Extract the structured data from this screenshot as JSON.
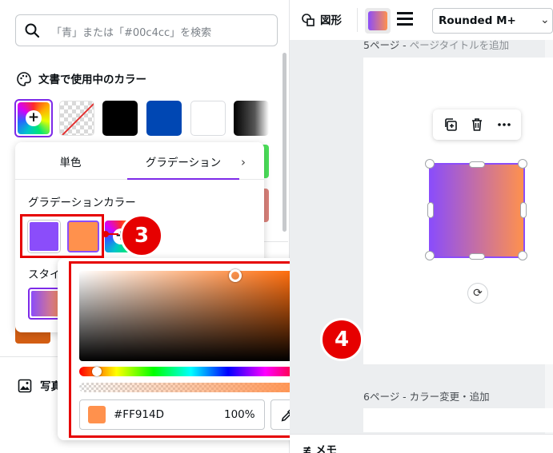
{
  "search": {
    "placeholder": "「青」または「#00c4cc」を検索"
  },
  "left_panel": {
    "doc_colors_title": "文書で使用中のカラー",
    "doc_colors": [
      "#000000",
      "#0047b3",
      "#ffffff"
    ],
    "photo_section_label": "写真の"
  },
  "gradient_popup": {
    "tabs": [
      {
        "label": "単色",
        "selected": false
      },
      {
        "label": "グラデーション",
        "selected": true
      }
    ],
    "next_arrow": "›",
    "gradient_colors_title": "グラデーションカラー",
    "gradient_stops": [
      "#8b4dfa",
      "#ff914d"
    ],
    "add_stop_label": "+",
    "style_title": "スタイル"
  },
  "color_picker": {
    "hex": "#FF914D",
    "opacity": "100%"
  },
  "annotations": {
    "badge_3": "3",
    "badge_4": "4"
  },
  "toolbar": {
    "shape_label": "図形",
    "font_name": "Rounded M+",
    "font_chevron": "⌄"
  },
  "canvas": {
    "page5_title": "5ページ - ",
    "page5_subtitle": "ページタイトルを追加",
    "page6_title": "6ページ - カラー変更・追加",
    "memo_label": "メモ"
  },
  "colors": {
    "accent": "#7d2ae8",
    "stop_purple": "#8b4dfa",
    "stop_orange": "#ff914d",
    "annotation_red": "#e60000"
  },
  "icons": {
    "search": "search-icon",
    "palette": "palette-icon",
    "image": "image-icon",
    "eyedropper": "eyedropper-icon",
    "duplicate": "duplicate-icon",
    "trash": "trash-icon",
    "more": "more-icon",
    "rotate": "rotate-icon",
    "shape": "shape-icon",
    "border_style": "border-style-icon"
  }
}
